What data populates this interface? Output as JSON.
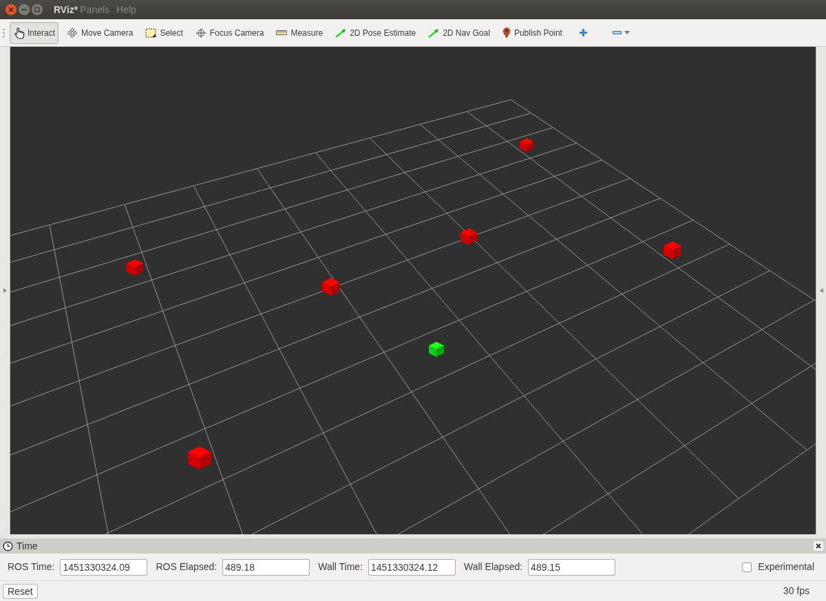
{
  "window": {
    "title": "RViz*"
  },
  "menu": [
    "Panels",
    "Help"
  ],
  "toolbar": [
    {
      "label": "Interact",
      "selected": true
    },
    {
      "label": "Move Camera",
      "selected": false
    },
    {
      "label": "Select",
      "selected": false
    },
    {
      "label": "Focus Camera",
      "selected": false
    },
    {
      "label": "Measure",
      "selected": false
    },
    {
      "label": "2D Pose Estimate",
      "selected": false
    },
    {
      "label": "2D Nav Goal",
      "selected": false
    },
    {
      "label": "Publish Point",
      "selected": false
    }
  ],
  "time_panel": {
    "title": "Time",
    "fields": [
      {
        "label": "ROS Time:",
        "value": "1451330324.09"
      },
      {
        "label": "ROS Elapsed:",
        "value": "489.18"
      },
      {
        "label": "Wall Time:",
        "value": "1451330324.12"
      },
      {
        "label": "Wall Elapsed:",
        "value": "489.15"
      }
    ],
    "experimental": {
      "label": "Experimental",
      "checked": false
    }
  },
  "status_bar": {
    "reset": "Reset",
    "fps": "30 fps"
  }
}
